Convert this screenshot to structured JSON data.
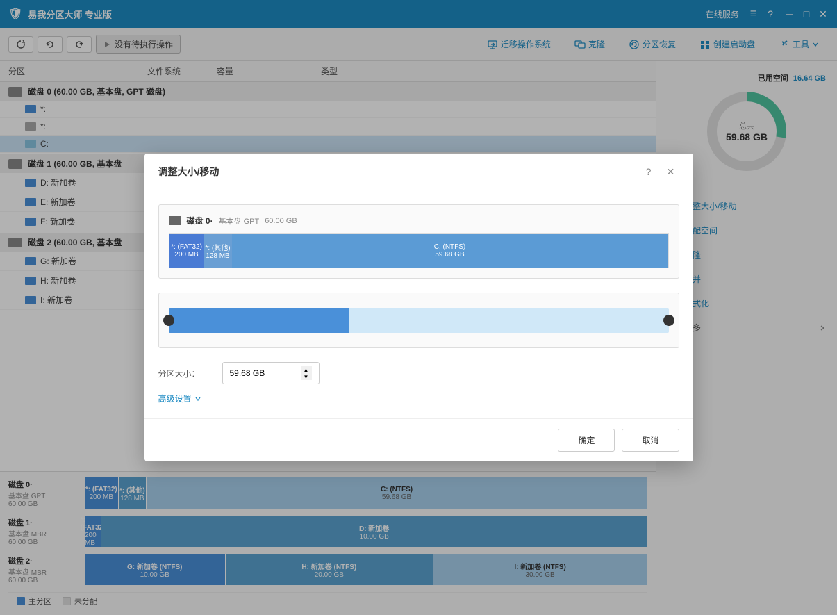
{
  "titlebar": {
    "title": "易我分区大师 专业版",
    "online_service": "在线服务",
    "logo_text": "🛡"
  },
  "toolbar": {
    "refresh_title": "刷新",
    "undo_title": "撤销",
    "redo_title": "重做",
    "no_op_label": "没有待执行操作",
    "migrate_label": "迁移操作系统",
    "clone_label": "克隆",
    "recovery_label": "分区恢复",
    "bootdisk_label": "创建启动盘",
    "tools_label": "工具"
  },
  "table": {
    "col_partition": "分区",
    "col_fs": "文件系统",
    "col_size": "容量",
    "col_type": "类型"
  },
  "disks": [
    {
      "id": "disk0",
      "name": "磁盘 0",
      "info": "(60.00 GB, 基本盘, GPT 磁盘)",
      "partitions": [
        {
          "letter": "*:",
          "fs": "",
          "size": "",
          "type": ""
        },
        {
          "letter": "*:",
          "fs": "",
          "size": "",
          "type": ""
        },
        {
          "letter": "C:",
          "fs": "",
          "size": "",
          "type": "",
          "selected": true
        }
      ]
    },
    {
      "id": "disk1",
      "name": "磁盘 1",
      "info": "(60.00 GB, 基本盘)",
      "partitions": [
        {
          "letter": "D: 新加卷",
          "fs": "",
          "size": "",
          "type": ""
        },
        {
          "letter": "E: 新加卷",
          "fs": "",
          "size": "",
          "type": ""
        },
        {
          "letter": "F: 新加卷",
          "fs": "",
          "size": "",
          "type": ""
        }
      ]
    },
    {
      "id": "disk2",
      "name": "磁盘 2",
      "info": "(60.00 GB, 基本盘)",
      "partitions": [
        {
          "letter": "G: 新加卷",
          "fs": "",
          "size": "",
          "type": ""
        },
        {
          "letter": "H: 新加卷",
          "fs": "",
          "size": "",
          "type": ""
        },
        {
          "letter": "I: 新加卷",
          "fs": "",
          "size": "",
          "type": ""
        }
      ]
    }
  ],
  "disk_visuals": [
    {
      "name": "磁盘 0·",
      "type": "基本盘 GPT",
      "size": "60.00 GB",
      "segs": [
        {
          "label": "*: (FAT32)",
          "size": "200 MB",
          "color": "blue",
          "width": "6"
        },
        {
          "label": "*: (其他)",
          "size": "128 MB",
          "color": "medium-blue",
          "width": "5"
        },
        {
          "label": "C: (NTFS)",
          "size": "59.68 GB",
          "color": "light-blue",
          "width": "89"
        }
      ]
    },
    {
      "name": "磁盘 1·",
      "type": "基本盘 MBR",
      "size": "60.00 GB",
      "segs": [
        {
          "label": "D: 新加卷",
          "size": "10.00 GB",
          "color": "blue",
          "width": "35"
        }
      ]
    },
    {
      "name": "磁盘 2·",
      "type": "基本盘 MBR",
      "size": "60.00 GB",
      "segs": [
        {
          "label": "G: 新加卷 (NTFS)",
          "size": "10.00 GB",
          "color": "blue",
          "width": "25"
        },
        {
          "label": "H: 新加卷 (NTFS)",
          "size": "20.00 GB",
          "color": "medium-blue",
          "width": "37"
        },
        {
          "label": "I: 新加卷 (NTFS)",
          "size": "30.00 GB",
          "color": "light-blue-seg",
          "width": "38"
        }
      ]
    }
  ],
  "legend": {
    "items": [
      {
        "label": "主分区",
        "color": "#4a90d9"
      },
      {
        "label": "未分配",
        "color": "#e0e0e0"
      }
    ]
  },
  "right_panel": {
    "used_label": "已用空间",
    "used_value": "16.64 GB",
    "total_label": "总共",
    "total_value": "59.68 GB",
    "actions": [
      {
        "label": "调整大小/移动",
        "icon": "resize"
      },
      {
        "label": "分配空间",
        "icon": "allocate"
      },
      {
        "label": "克隆",
        "icon": "clone"
      },
      {
        "label": "合并",
        "icon": "merge"
      },
      {
        "label": "格式化",
        "icon": "format"
      },
      {
        "label": "更多",
        "icon": "more",
        "has_chevron": true
      }
    ]
  },
  "modal": {
    "title": "调整大小/移动",
    "disk_name": "磁盘 0·",
    "disk_type": "基本盘 GPT",
    "disk_size_total": "60.00 GB",
    "seg_fat32_name": "*: (FAT32)",
    "seg_fat32_size": "200 MB",
    "seg_other_name": "*: (其他)",
    "seg_other_size": "128 MB",
    "seg_ntfs_name": "C: (NTFS)",
    "seg_ntfs_size": "59.68 GB",
    "size_label": "分区大小：",
    "size_value": "59.68 GB",
    "advanced_label": "高级设置",
    "confirm_label": "确定",
    "cancel_label": "取消"
  }
}
